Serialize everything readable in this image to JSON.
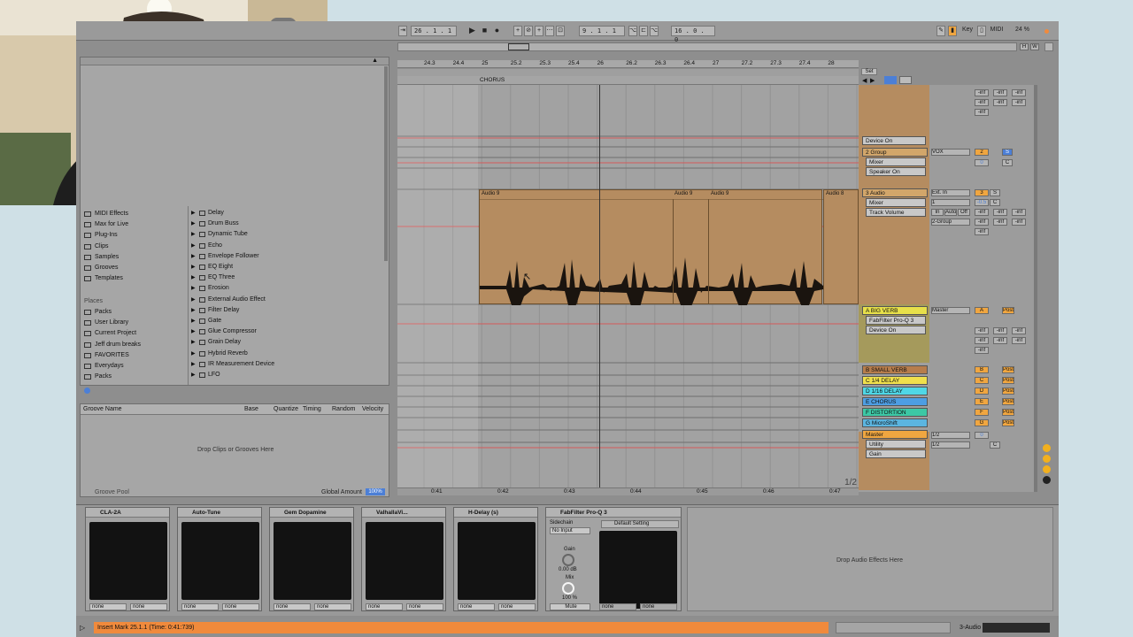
{
  "transport": {
    "position": "26 . 1 . 1",
    "loop_start": "9 . 1 . 1",
    "loop_length": "16 . 0 . 0",
    "key_label": "Key",
    "midi_label": "MIDI",
    "zoom": "24 %"
  },
  "overview": {
    "h_label": "H",
    "w_label": "W"
  },
  "browser": {
    "categories": [
      "MIDI Effects",
      "Max for Live",
      "Plug-Ins",
      "Clips",
      "Samples",
      "Grooves",
      "Templates"
    ],
    "places_label": "Places",
    "places": [
      "Packs",
      "User Library",
      "Current Project",
      "Jeff drum breaks",
      "FAVORITES",
      "Everydays",
      "Packs"
    ],
    "effects": [
      "Delay",
      "Drum Buss",
      "Dynamic Tube",
      "Echo",
      "Envelope Follower",
      "EQ Eight",
      "EQ Three",
      "Erosion",
      "External Audio Effect",
      "Filter Delay",
      "Gate",
      "Glue Compressor",
      "Grain Delay",
      "Hybrid Reverb",
      "IR Measurement Device",
      "LFO"
    ]
  },
  "groove_pool": {
    "headers": [
      "Groove Name",
      "Base",
      "Quantize",
      "Timing",
      "Random",
      "Velocity"
    ],
    "drop_text": "Drop Clips or Grooves Here",
    "title": "Groove Pool",
    "global_amount_label": "Global Amount",
    "global_amount": "100%"
  },
  "ruler": {
    "bars": [
      "24.3",
      "24.4",
      "25",
      "25.2",
      "25.3",
      "25.4",
      "26",
      "26.2",
      "26.3",
      "26.4",
      "27",
      "27.2",
      "27.3",
      "27.4",
      "28"
    ],
    "locator": "CHORUS",
    "set_label": "Set",
    "times": [
      "0:41",
      "0:42",
      "0:43",
      "0:44",
      "0:45",
      "0:46",
      "0:47"
    ],
    "page": "1/2"
  },
  "clips": {
    "audio_name": "Audio 9",
    "audio_name_b": "Audio 8"
  },
  "tracks": [
    {
      "name": "2 Group",
      "color": "#d2a66a",
      "device": "Device On",
      "chain": "Mixer",
      "param": "Speaker On",
      "input": "VOX",
      "num": "2",
      "solo": "S"
    },
    {
      "name": "3 Audio",
      "color": "#d2a66a",
      "chain": "Mixer",
      "param": "Track Volume",
      "input": "Ext. In",
      "input_ch": "1",
      "output": "2-Group",
      "num": "3",
      "solo": "S",
      "vol": "-0.5",
      "pan": "C"
    },
    {
      "name": "A BIG VERB",
      "color": "#e7e04a",
      "device": "FabFilter Pro-Q 3",
      "param": "Device On",
      "output": "Master",
      "letter": "A"
    },
    {
      "name": "B SMALL VERB",
      "color": "#b77d4c",
      "letter": "B"
    },
    {
      "name": "C 1/4 DELAY",
      "color": "#f0e04c",
      "letter": "C"
    },
    {
      "name": "D 1/16 DELAY",
      "color": "#4fd7e6",
      "letter": "D"
    },
    {
      "name": "E CHORUS",
      "color": "#4d9ee3",
      "letter": "E"
    },
    {
      "name": "F DISTORTION",
      "color": "#3cc8a5",
      "letter": "F"
    },
    {
      "name": "G MicroShift",
      "color": "#5bb5e0",
      "letter": "G"
    },
    {
      "name": "Master",
      "color": "#f0a640",
      "device": "Utility",
      "param": "Gain",
      "io1": "1/2",
      "io2": "1/2",
      "pan": "C"
    }
  ],
  "mixer": {
    "inf": "-inf",
    "zero": "0",
    "center": "C",
    "post": "Post",
    "in_label": "In",
    "auto_label": "Auto",
    "off_label": "Off"
  },
  "devices": [
    {
      "name": "CLA-2A",
      "sel_a": "none",
      "sel_b": "none"
    },
    {
      "name": "Auto-Tune",
      "sel_a": "none",
      "sel_b": "none"
    },
    {
      "name": "Gem Dopamine",
      "sel_a": "none",
      "sel_b": "none"
    },
    {
      "name": "ValhallaVi...",
      "sel_a": "none",
      "sel_b": "none"
    },
    {
      "name": "H-Delay (s)",
      "sel_a": "none",
      "sel_b": "none"
    }
  ],
  "fabfilter": {
    "name": "FabFilter Pro-Q 3",
    "sidechain_label": "Sidechain",
    "input": "No Input",
    "gain_label": "Gain",
    "gain_value": "0.00 dB",
    "mix_label": "Mix",
    "mix_value": "100 %",
    "mute_label": "Mute",
    "preset": "Default Setting",
    "sel_a": "none",
    "sel_b": "none"
  },
  "drop_effects": "Drop Audio Effects Here",
  "status": {
    "message": "Insert Mark 25.1.1 (Time: 0:41:739)",
    "track_label": "3-Audio"
  },
  "colors": {
    "clip": "#b58c60",
    "accent": "#f08a3c",
    "status": "#f08a3c"
  }
}
